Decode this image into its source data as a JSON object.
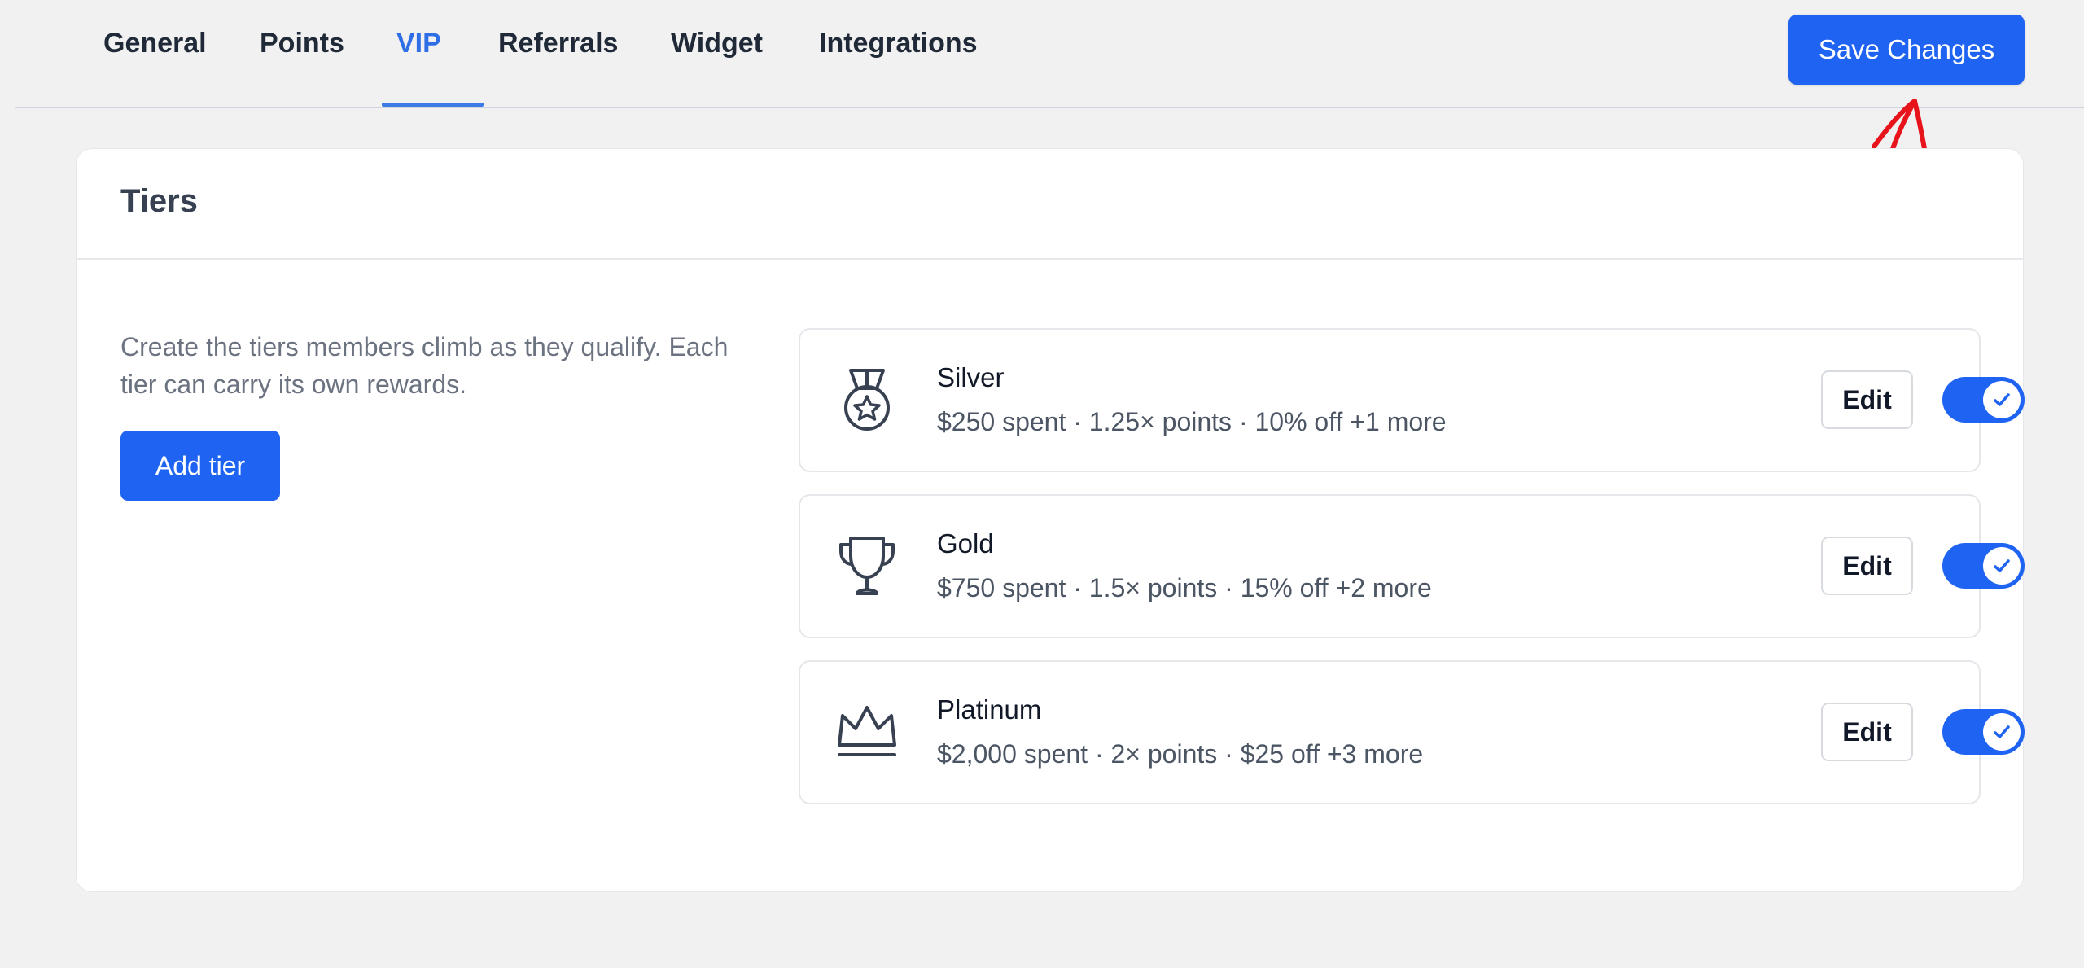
{
  "tabs": [
    {
      "label": "General"
    },
    {
      "label": "Points"
    },
    {
      "label": "VIP",
      "active": true
    },
    {
      "label": "Referrals"
    },
    {
      "label": "Widget"
    },
    {
      "label": "Integrations"
    }
  ],
  "save_label": "Save Changes",
  "card": {
    "title": "Tiers",
    "description": "Create the tiers members climb as they qualify. Each tier can carry its own rewards.",
    "add_label": "Add tier"
  },
  "tiers": [
    {
      "name": "Silver",
      "desc": "$250 spent · 1.25× points · 10% off +1 more",
      "icon": "medal-icon",
      "edit_label": "Edit",
      "enabled": true
    },
    {
      "name": "Gold",
      "desc": "$750 spent · 1.5× points · 15% off +2 more",
      "icon": "trophy-icon",
      "edit_label": "Edit",
      "enabled": true
    },
    {
      "name": "Platinum",
      "desc": "$2,000 spent · 2× points · $25 off +3 more",
      "icon": "crown-icon",
      "edit_label": "Edit",
      "enabled": true
    }
  ],
  "colors": {
    "accent": "#1f63f2",
    "active_tab": "#2f6fe6",
    "annotation": "#e8141c"
  }
}
